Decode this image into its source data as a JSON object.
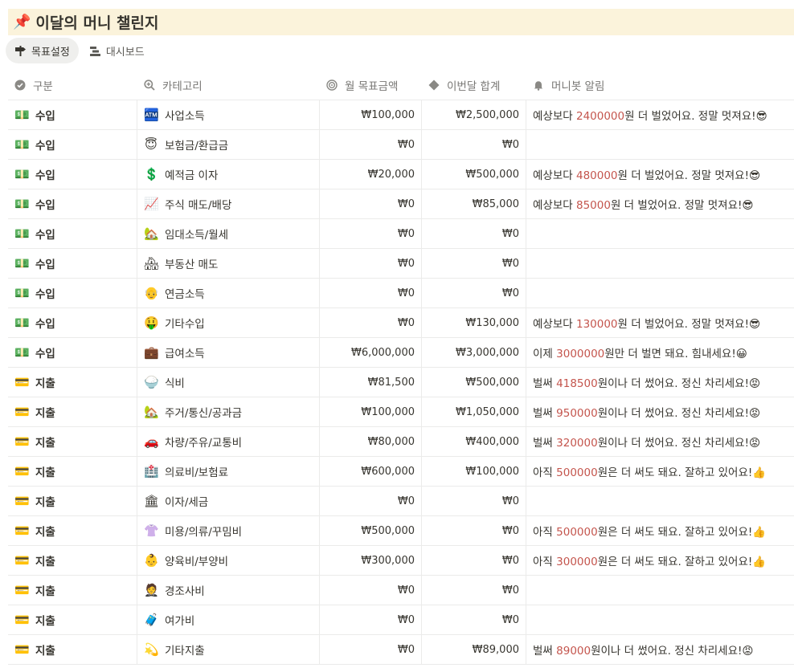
{
  "page": {
    "pin_icon": "pushpin-icon",
    "title": "이달의 머니 챌린지"
  },
  "tabs": [
    {
      "label": "목표설정",
      "icon": "signpost-icon",
      "active": true
    },
    {
      "label": "대시보드",
      "icon": "chart-bars-icon",
      "active": false
    }
  ],
  "columns": {
    "gubun": "구분",
    "category": "카테고리",
    "target": "월 목표금액",
    "total": "이번달 합계",
    "alert": "머니봇 알림"
  },
  "rows": [
    {
      "g_icon": "💵",
      "gubun": "수입",
      "c_icon": "🏧",
      "category": "사업소득",
      "target": "₩100,000",
      "total": "₩2,500,000",
      "a_pre": "예상보다 ",
      "a_num": "2400000",
      "a_post": "원 더 벌었어요. 정말 멋져요!😎"
    },
    {
      "g_icon": "💵",
      "gubun": "수입",
      "c_icon": "😇",
      "category": "보험금/환급금",
      "target": "₩0",
      "total": "₩0",
      "a_pre": "",
      "a_num": "",
      "a_post": ""
    },
    {
      "g_icon": "💵",
      "gubun": "수입",
      "c_icon": "💲",
      "category": "예적금 이자",
      "target": "₩20,000",
      "total": "₩500,000",
      "a_pre": "예상보다 ",
      "a_num": "480000",
      "a_post": "원 더 벌었어요. 정말 멋져요!😎"
    },
    {
      "g_icon": "💵",
      "gubun": "수입",
      "c_icon": "📈",
      "category": "주식 매도/배당",
      "target": "₩0",
      "total": "₩85,000",
      "a_pre": "예상보다 ",
      "a_num": "85000",
      "a_post": "원 더 벌었어요. 정말 멋져요!😎"
    },
    {
      "g_icon": "💵",
      "gubun": "수입",
      "c_icon": "🏡",
      "category": "임대소득/월세",
      "target": "₩0",
      "total": "₩0",
      "a_pre": "",
      "a_num": "",
      "a_post": ""
    },
    {
      "g_icon": "💵",
      "gubun": "수입",
      "c_icon": "🏘",
      "category": "부동산 매도",
      "target": "₩0",
      "total": "₩0",
      "a_pre": "",
      "a_num": "",
      "a_post": ""
    },
    {
      "g_icon": "💵",
      "gubun": "수입",
      "c_icon": "👴",
      "category": "연금소득",
      "target": "₩0",
      "total": "₩0",
      "a_pre": "",
      "a_num": "",
      "a_post": ""
    },
    {
      "g_icon": "💵",
      "gubun": "수입",
      "c_icon": "🤑",
      "category": "기타수입",
      "target": "₩0",
      "total": "₩130,000",
      "a_pre": "예상보다 ",
      "a_num": "130000",
      "a_post": "원 더 벌었어요. 정말 멋져요!😎"
    },
    {
      "g_icon": "💵",
      "gubun": "수입",
      "c_icon": "💼",
      "category": "급여소득",
      "target": "₩6,000,000",
      "total": "₩3,000,000",
      "a_pre": "이제 ",
      "a_num": "3000000",
      "a_post": "원만 더 벌면 돼요. 힘내세요!😀"
    },
    {
      "g_icon": "💳",
      "gubun": "지출",
      "c_icon": "🍚",
      "category": "식비",
      "target": "₩81,500",
      "total": "₩500,000",
      "a_pre": "벌써 ",
      "a_num": "418500",
      "a_post": "원이나 더 썼어요. 정신 차리세요!😡"
    },
    {
      "g_icon": "💳",
      "gubun": "지출",
      "c_icon": "🏡",
      "category": "주거/통신/공과금",
      "target": "₩100,000",
      "total": "₩1,050,000",
      "a_pre": "벌써 ",
      "a_num": "950000",
      "a_post": "원이나 더 썼어요. 정신 차리세요!😡"
    },
    {
      "g_icon": "💳",
      "gubun": "지출",
      "c_icon": "🚗",
      "category": "차량/주유/교통비",
      "target": "₩80,000",
      "total": "₩400,000",
      "a_pre": "벌써 ",
      "a_num": "320000",
      "a_post": "원이나 더 썼어요. 정신 차리세요!😡"
    },
    {
      "g_icon": "💳",
      "gubun": "지출",
      "c_icon": "🏥",
      "category": "의료비/보험료",
      "target": "₩600,000",
      "total": "₩100,000",
      "a_pre": "아직 ",
      "a_num": "500000",
      "a_post": "원은 더 써도 돼요. 잘하고 있어요!👍"
    },
    {
      "g_icon": "💳",
      "gubun": "지출",
      "c_icon": "🏛",
      "category": "이자/세금",
      "target": "₩0",
      "total": "₩0",
      "a_pre": "",
      "a_num": "",
      "a_post": ""
    },
    {
      "g_icon": "💳",
      "gubun": "지출",
      "c_icon": "👚",
      "category": "미용/의류/꾸밈비",
      "target": "₩500,000",
      "total": "₩0",
      "a_pre": "아직 ",
      "a_num": "500000",
      "a_post": "원은 더 써도 돼요. 잘하고 있어요!👍"
    },
    {
      "g_icon": "💳",
      "gubun": "지출",
      "c_icon": "👶",
      "category": "양육비/부양비",
      "target": "₩300,000",
      "total": "₩0",
      "a_pre": "아직 ",
      "a_num": "300000",
      "a_post": "원은 더 써도 돼요. 잘하고 있어요!👍"
    },
    {
      "g_icon": "💳",
      "gubun": "지출",
      "c_icon": "🤵",
      "category": "경조사비",
      "target": "₩0",
      "total": "₩0",
      "a_pre": "",
      "a_num": "",
      "a_post": ""
    },
    {
      "g_icon": "💳",
      "gubun": "지출",
      "c_icon": "🧳",
      "category": "여가비",
      "target": "₩0",
      "total": "₩0",
      "a_pre": "",
      "a_num": "",
      "a_post": ""
    },
    {
      "g_icon": "💳",
      "gubun": "지출",
      "c_icon": "💫",
      "category": "기타지출",
      "target": "₩0",
      "total": "₩89,000",
      "a_pre": "벌써 ",
      "a_num": "89000",
      "a_post": "원이나 더 썼어요. 정신 차리세요!😡"
    }
  ]
}
